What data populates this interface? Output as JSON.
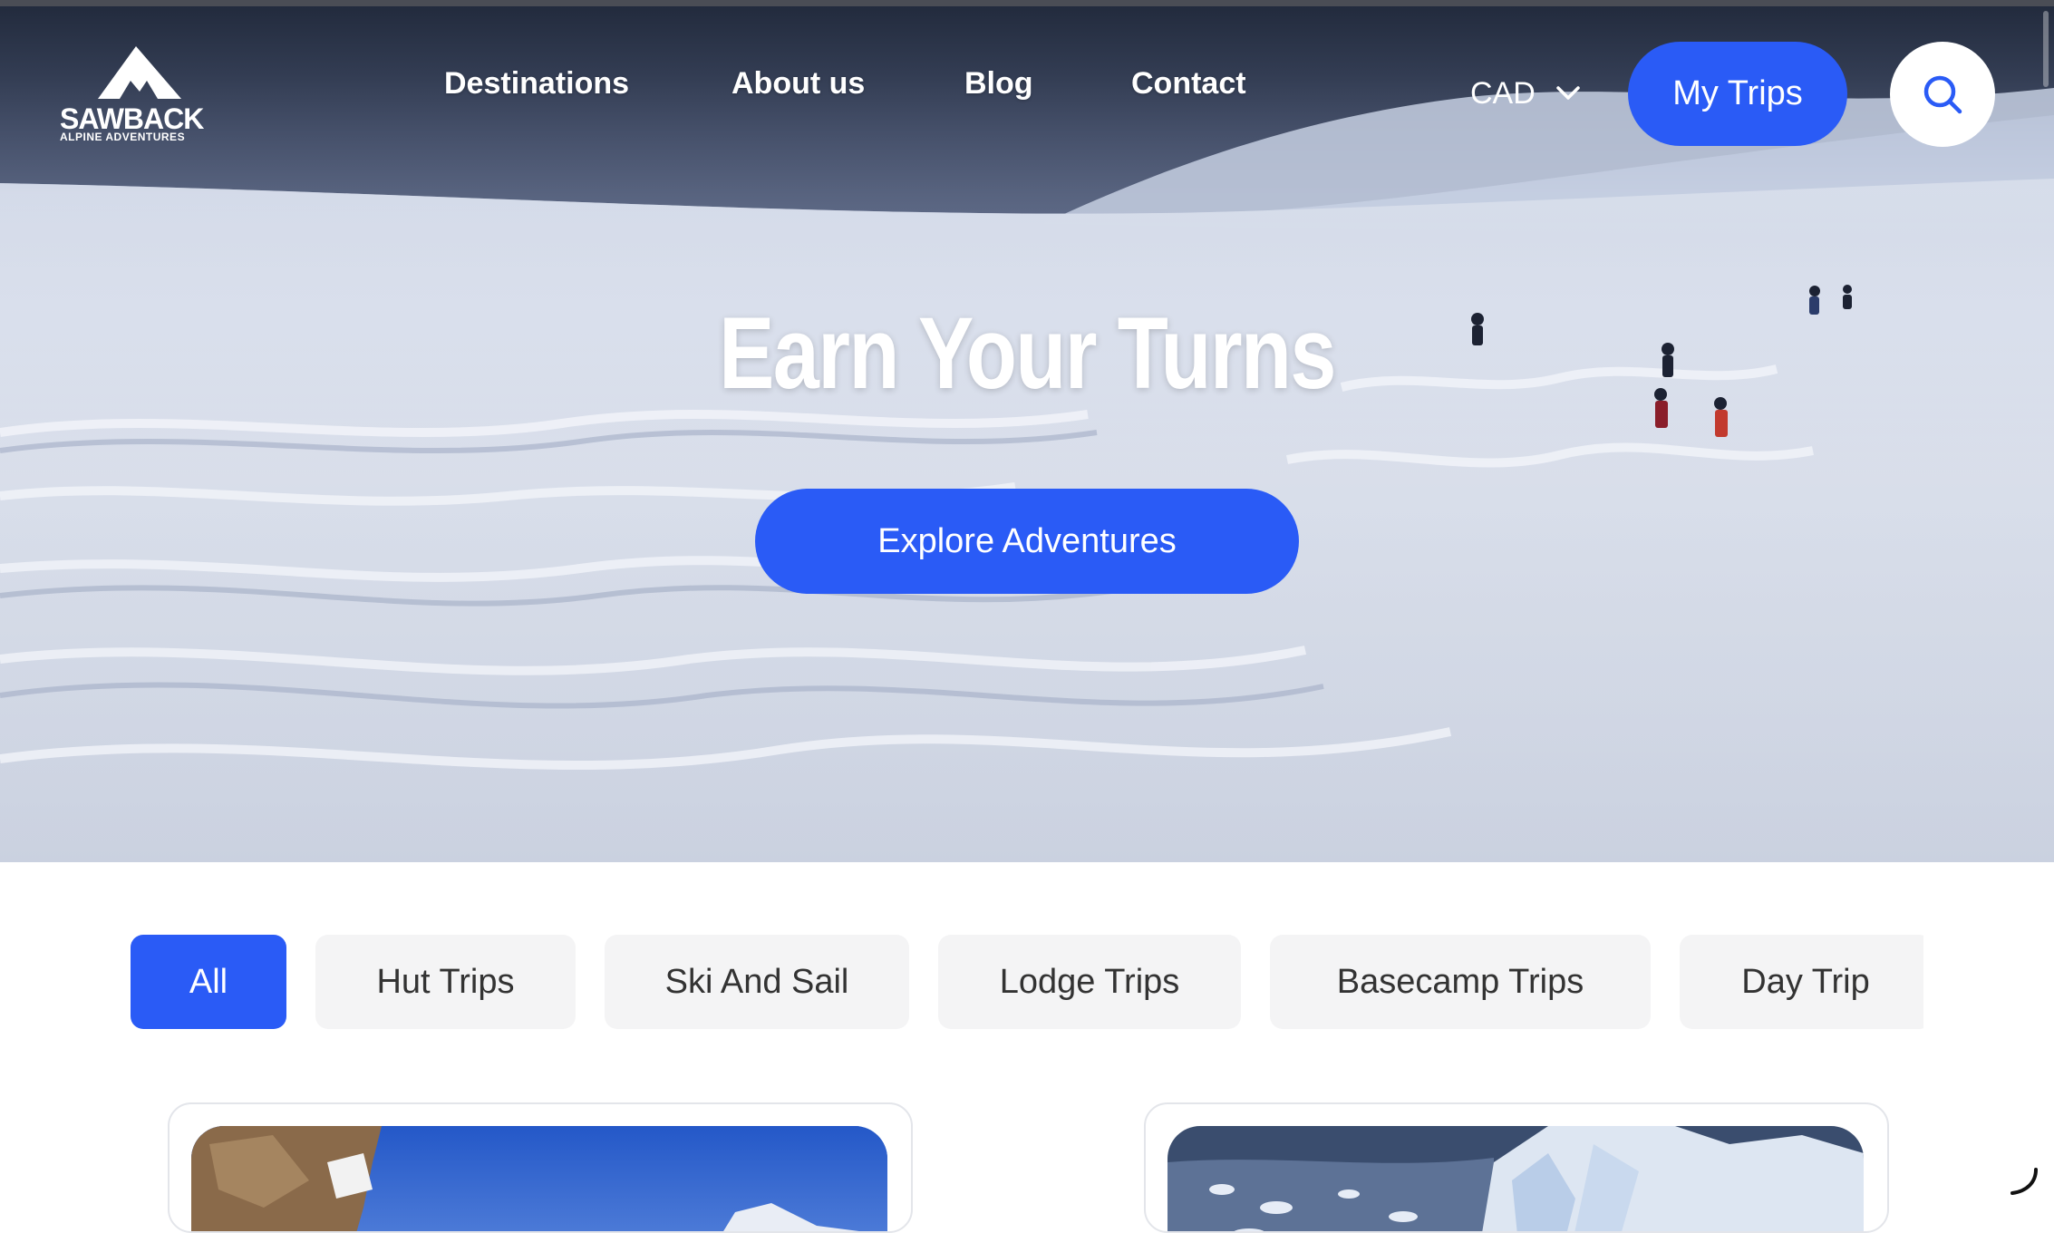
{
  "brand": {
    "name": "SAWBACK",
    "tagline": "ALPINE ADVENTURES"
  },
  "nav": {
    "links": [
      "Destinations",
      "About us",
      "Blog",
      "Contact"
    ],
    "currency": "CAD",
    "my_trips": "My Trips"
  },
  "hero": {
    "title": "Earn Your Turns",
    "cta": "Explore Adventures"
  },
  "filters": {
    "selected": "All",
    "items": [
      "All",
      "Hut Trips",
      "Ski And Sail",
      "Lodge Trips",
      "Basecamp Trips",
      "Day Trip"
    ]
  },
  "colors": {
    "accent": "#2a5bf6",
    "chip_bg": "#f4f4f5"
  },
  "icons": {
    "logo": "mountain-logo-icon",
    "currency_dropdown": "chevron-down-icon",
    "search": "search-icon",
    "loading": "loading-spinner-icon"
  }
}
